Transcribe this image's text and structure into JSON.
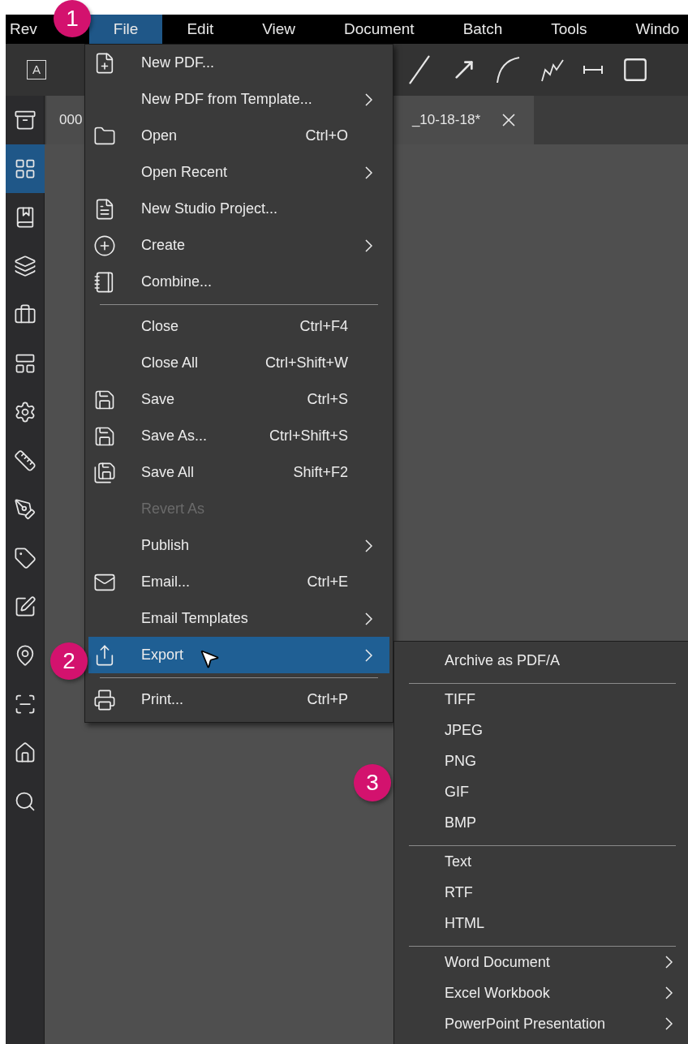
{
  "menu_bar": [
    {
      "label": "Rev",
      "selected": false
    },
    {
      "label": "File",
      "selected": true
    },
    {
      "label": "Edit",
      "selected": false
    },
    {
      "label": "View",
      "selected": false
    },
    {
      "label": "Document",
      "selected": false
    },
    {
      "label": "Batch",
      "selected": false
    },
    {
      "label": "Tools",
      "selected": false
    },
    {
      "label": "Windo",
      "selected": false
    }
  ],
  "toolbar": {
    "text_tool": "A"
  },
  "sidebar": {
    "items": [
      {
        "selected": false
      },
      {
        "selected": true
      },
      {
        "selected": false
      },
      {
        "selected": false
      },
      {
        "selected": false
      },
      {
        "selected": false
      },
      {
        "selected": false
      },
      {
        "selected": false
      },
      {
        "selected": false
      },
      {
        "selected": false
      },
      {
        "selected": false
      },
      {
        "selected": false
      },
      {
        "selected": false
      },
      {
        "selected": false
      },
      {
        "selected": false
      }
    ]
  },
  "document_tab": {
    "title_start": "000",
    "title_end": "_10-18-18*"
  },
  "file_menu": [
    {
      "kind": "item",
      "label": "New PDF...",
      "submenu": false,
      "disabled": false,
      "selected": false
    },
    {
      "kind": "item",
      "label": "New PDF from Template...",
      "submenu": true,
      "disabled": false,
      "selected": false
    },
    {
      "kind": "item",
      "label": "Open",
      "shortcut": "Ctrl+O",
      "submenu": false,
      "disabled": false,
      "selected": false
    },
    {
      "kind": "item",
      "label": "Open Recent",
      "submenu": true,
      "disabled": false,
      "selected": false
    },
    {
      "kind": "item",
      "label": "New Studio Project...",
      "submenu": false,
      "disabled": false,
      "selected": false
    },
    {
      "kind": "item",
      "label": "Create",
      "submenu": true,
      "disabled": false,
      "selected": false
    },
    {
      "kind": "item",
      "label": "Combine...",
      "submenu": false,
      "disabled": false,
      "selected": false
    },
    {
      "kind": "separator"
    },
    {
      "kind": "item",
      "label": "Close",
      "shortcut": "Ctrl+F4",
      "submenu": false,
      "disabled": false,
      "selected": false
    },
    {
      "kind": "item",
      "label": "Close All",
      "shortcut": "Ctrl+Shift+W",
      "submenu": false,
      "disabled": false,
      "selected": false
    },
    {
      "kind": "item",
      "label": "Save",
      "shortcut": "Ctrl+S",
      "submenu": false,
      "disabled": false,
      "selected": false
    },
    {
      "kind": "item",
      "label": "Save As...",
      "shortcut": "Ctrl+Shift+S",
      "submenu": false,
      "disabled": false,
      "selected": false
    },
    {
      "kind": "item",
      "label": "Save All",
      "shortcut": "Shift+F2",
      "submenu": false,
      "disabled": false,
      "selected": false
    },
    {
      "kind": "item",
      "label": "Revert As",
      "submenu": false,
      "disabled": true,
      "selected": false
    },
    {
      "kind": "item",
      "label": "Publish",
      "submenu": true,
      "disabled": false,
      "selected": false
    },
    {
      "kind": "item",
      "label": "Email...",
      "shortcut": "Ctrl+E",
      "submenu": false,
      "disabled": false,
      "selected": false
    },
    {
      "kind": "item",
      "label": "Email Templates",
      "submenu": true,
      "disabled": false,
      "selected": false
    },
    {
      "kind": "item",
      "label": "Export",
      "submenu": true,
      "disabled": false,
      "selected": true
    },
    {
      "kind": "separator"
    },
    {
      "kind": "item",
      "label": "Print...",
      "shortcut": "Ctrl+P",
      "submenu": false,
      "disabled": false,
      "selected": false
    }
  ],
  "export_submenu": [
    {
      "kind": "item",
      "label": "Archive as PDF/A",
      "submenu": false
    },
    {
      "kind": "separator"
    },
    {
      "kind": "item",
      "label": "TIFF",
      "submenu": false
    },
    {
      "kind": "item",
      "label": "JPEG",
      "submenu": false
    },
    {
      "kind": "item",
      "label": "PNG",
      "submenu": false
    },
    {
      "kind": "item",
      "label": "GIF",
      "submenu": false
    },
    {
      "kind": "item",
      "label": "BMP",
      "submenu": false
    },
    {
      "kind": "separator"
    },
    {
      "kind": "item",
      "label": "Text",
      "submenu": false
    },
    {
      "kind": "item",
      "label": "RTF",
      "submenu": false
    },
    {
      "kind": "item",
      "label": "HTML",
      "submenu": false
    },
    {
      "kind": "separator"
    },
    {
      "kind": "item",
      "label": "Word Document",
      "submenu": true
    },
    {
      "kind": "item",
      "label": "Excel Workbook",
      "submenu": true
    },
    {
      "kind": "item",
      "label": "PowerPoint Presentation",
      "submenu": true
    }
  ],
  "callouts": [
    {
      "number": "1"
    },
    {
      "number": "2"
    },
    {
      "number": "3"
    }
  ]
}
